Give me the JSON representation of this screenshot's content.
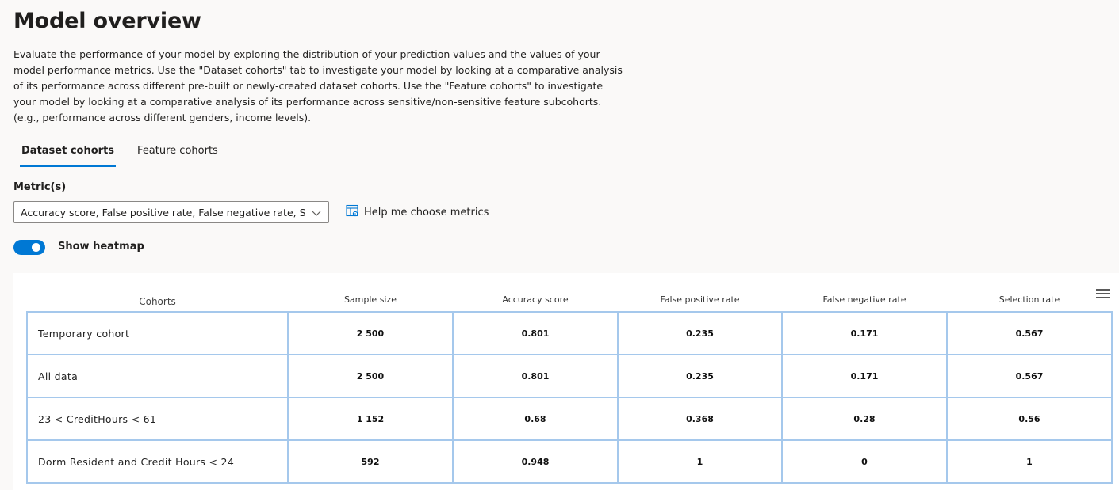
{
  "page": {
    "title": "Model overview",
    "description_lines": [
      "Evaluate the performance of your model by exploring the distribution of your prediction values and the values of your",
      "model performance metrics. Use the \"Dataset cohorts\" tab to investigate your model by looking at a comparative analysis",
      "of its performance across different pre-built or newly-created dataset cohorts. Use the \"Feature cohorts\" to investigate",
      "your model by looking at a comparative analysis of its performance across sensitive/non-sensitive feature subcohorts.",
      "(e.g., performance across different genders, income levels)."
    ]
  },
  "tabs": [
    {
      "label": "Dataset cohorts",
      "active": true
    },
    {
      "label": "Feature cohorts",
      "active": false
    }
  ],
  "metrics": {
    "label": "Metric(s)",
    "selected_value": "Accuracy score, False positive rate, False negative rate, S...",
    "help_link": "Help me choose metrics"
  },
  "heatmap_toggle": {
    "label": "Show heatmap",
    "on": true
  },
  "table": {
    "headers": [
      "Cohorts",
      "Sample size",
      "Accuracy score",
      "False positive rate",
      "False negative rate",
      "Selection rate"
    ],
    "rows": [
      {
        "cohort": "Temporary cohort",
        "values": [
          "2 500",
          "0.801",
          "0.235",
          "0.171",
          "0.567"
        ]
      },
      {
        "cohort": "All data",
        "values": [
          "2 500",
          "0.801",
          "0.235",
          "0.171",
          "0.567"
        ]
      },
      {
        "cohort": "23 < CreditHours < 61",
        "values": [
          "1 152",
          "0.68",
          "0.368",
          "0.28",
          "0.56"
        ]
      },
      {
        "cohort": "Dorm Resident and Credit Hours < 24",
        "values": [
          "592",
          "0.948",
          "1",
          "0",
          "1"
        ]
      }
    ]
  },
  "colors": {
    "accent": "#0078d4",
    "cell_border": "#a5c8ec"
  },
  "icons": {
    "dropdown": "chevron-down-icon",
    "help": "table-settings-icon",
    "table_menu": "hamburger-menu-icon"
  }
}
